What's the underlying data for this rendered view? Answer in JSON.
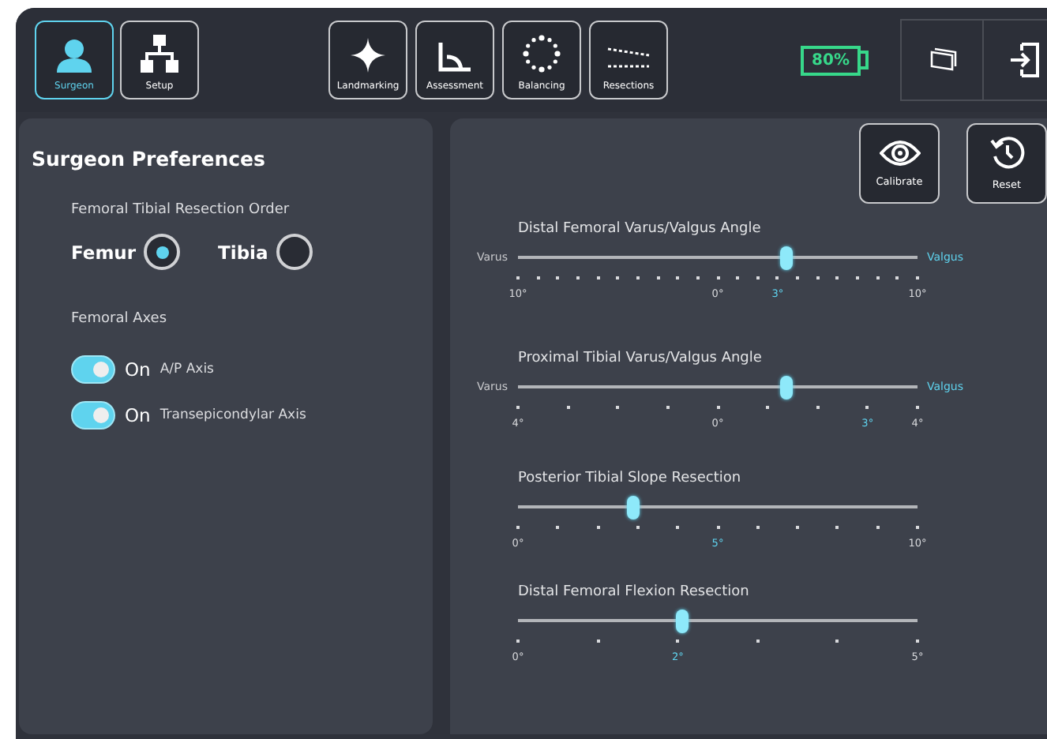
{
  "nav_left": [
    {
      "label": "Surgeon",
      "selected": true
    },
    {
      "label": "Setup",
      "selected": false
    }
  ],
  "nav_center": [
    {
      "label": "Landmarking",
      "selected": false
    },
    {
      "label": "Assessment",
      "selected": false
    },
    {
      "label": "Balancing",
      "selected": false
    },
    {
      "label": "Resections",
      "selected": false
    }
  ],
  "battery": {
    "text": "80%"
  },
  "preferences": {
    "title": "Surgeon Preferences",
    "order_label": "Femoral Tibial Resection Order",
    "order_options": [
      {
        "label": "Femur",
        "selected": true
      },
      {
        "label": "Tibia",
        "selected": false
      }
    ],
    "axes_label": "Femoral Axes",
    "axes": [
      {
        "state": "On",
        "label": "A/P Axis",
        "on": true
      },
      {
        "state": "On",
        "label": "Transepicondylar Axis",
        "on": true
      }
    ]
  },
  "actions": [
    {
      "label": "Calibrate"
    },
    {
      "label": "Reset"
    }
  ],
  "sliders": [
    {
      "title": "Distal Femoral Varus/Valgus Angle",
      "left": "Varus",
      "right": "Valgus",
      "level": 0.65,
      "ticks": [
        {
          "kind": "label",
          "label": "10°",
          "highlighted": false
        },
        {
          "kind": "dot"
        },
        {
          "kind": "dot"
        },
        {
          "kind": "dot"
        },
        {
          "kind": "dot"
        },
        {
          "kind": "dot"
        },
        {
          "kind": "dot"
        },
        {
          "kind": "dot"
        },
        {
          "kind": "dot"
        },
        {
          "kind": "dot"
        },
        {
          "kind": "label",
          "label": "0°",
          "highlighted": false
        },
        {
          "kind": "dot"
        },
        {
          "kind": "dot"
        },
        {
          "kind": "label",
          "label": "3°",
          "highlighted": true
        },
        {
          "kind": "dot"
        },
        {
          "kind": "dot"
        },
        {
          "kind": "dot"
        },
        {
          "kind": "dot"
        },
        {
          "kind": "dot"
        },
        {
          "kind": "dot"
        },
        {
          "kind": "label",
          "label": "10°",
          "highlighted": false
        }
      ]
    },
    {
      "title": "Proximal Tibial Varus/Valgus Angle",
      "left": "Varus",
      "right": "Valgus",
      "level": 0.65,
      "ticks": [
        {
          "kind": "label",
          "label": "4°",
          "highlighted": false
        },
        {
          "kind": "dot"
        },
        {
          "kind": "dot"
        },
        {
          "kind": "dot"
        },
        {
          "kind": "label",
          "label": "0°",
          "highlighted": false
        },
        {
          "kind": "dot"
        },
        {
          "kind": "dot"
        },
        {
          "kind": "label",
          "label": "3°",
          "highlighted": true
        },
        {
          "kind": "label",
          "label": "4°",
          "highlighted": false
        }
      ]
    },
    {
      "title": "Posterior Tibial Slope Resection",
      "level": 0.28,
      "ticks": [
        {
          "kind": "label",
          "label": "0°",
          "highlighted": false
        },
        {
          "kind": "dot"
        },
        {
          "kind": "dot"
        },
        {
          "kind": "dot"
        },
        {
          "kind": "dot"
        },
        {
          "kind": "label",
          "label": "5°",
          "highlighted": true
        },
        {
          "kind": "dot"
        },
        {
          "kind": "dot"
        },
        {
          "kind": "dot"
        },
        {
          "kind": "dot"
        },
        {
          "kind": "label",
          "label": "10°",
          "highlighted": false
        }
      ]
    },
    {
      "title": "Distal Femoral Flexion Resection",
      "level": 0.4,
      "ticks": [
        {
          "kind": "label",
          "label": "0°",
          "highlighted": false
        },
        {
          "kind": "dot"
        },
        {
          "kind": "label",
          "label": "2°",
          "highlighted": true
        },
        {
          "kind": "dot"
        },
        {
          "kind": "dot"
        },
        {
          "kind": "label",
          "label": "5°",
          "highlighted": false
        }
      ]
    }
  ]
}
